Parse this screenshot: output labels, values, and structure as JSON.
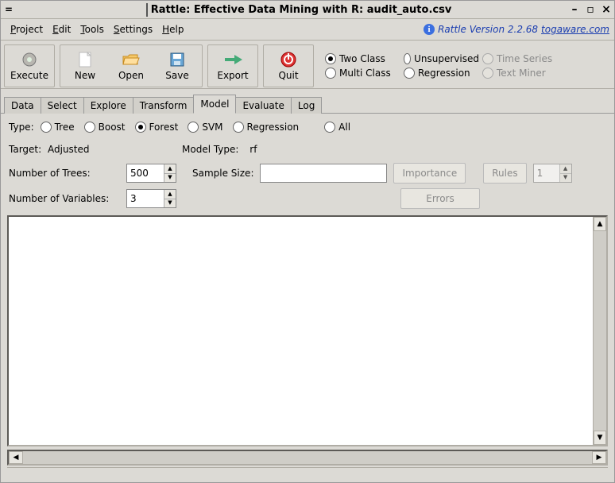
{
  "titlebar": {
    "title": "Rattle: Effective Data Mining with R: audit_auto.csv"
  },
  "menubar": {
    "items": [
      {
        "label": "Project",
        "ul": "P"
      },
      {
        "label": "Edit",
        "ul": "E"
      },
      {
        "label": "Tools",
        "ul": "T"
      },
      {
        "label": "Settings",
        "ul": "S"
      },
      {
        "label": "Help",
        "ul": "H"
      }
    ],
    "version_text": "Rattle Version 2.2.68",
    "version_link": "togaware.com"
  },
  "toolbar": {
    "buttons": [
      {
        "name": "execute",
        "label": "Execute"
      },
      {
        "name": "new",
        "label": "New"
      },
      {
        "name": "open",
        "label": "Open"
      },
      {
        "name": "save",
        "label": "Save"
      },
      {
        "name": "export",
        "label": "Export"
      },
      {
        "name": "quit",
        "label": "Quit"
      }
    ],
    "right_radios_row1": [
      {
        "label": "Two Class",
        "selected": true,
        "disabled": false
      },
      {
        "label": "Unsupervised",
        "selected": false,
        "disabled": false
      },
      {
        "label": "Time Series",
        "selected": false,
        "disabled": true
      }
    ],
    "right_radios_row2": [
      {
        "label": "Multi Class",
        "selected": false,
        "disabled": false
      },
      {
        "label": "Regression",
        "selected": false,
        "disabled": false
      },
      {
        "label": "Text Miner",
        "selected": false,
        "disabled": true
      }
    ]
  },
  "tabs": [
    "Data",
    "Select",
    "Explore",
    "Transform",
    "Model",
    "Evaluate",
    "Log"
  ],
  "active_tab": "Model",
  "model_panel": {
    "type_label": "Type:",
    "type_options": [
      {
        "label": "Tree",
        "selected": false
      },
      {
        "label": "Boost",
        "selected": false
      },
      {
        "label": "Forest",
        "selected": true
      },
      {
        "label": "SVM",
        "selected": false
      },
      {
        "label": "Regression",
        "selected": false
      },
      {
        "label": "All",
        "selected": false
      }
    ],
    "target_label": "Target:",
    "target_value": "Adjusted",
    "model_type_label": "Model Type:",
    "model_type_value": "rf",
    "num_trees_label": "Number of Trees:",
    "num_trees_value": "500",
    "sample_size_label": "Sample Size:",
    "sample_size_value": "",
    "importance_btn": "Importance",
    "rules_btn": "Rules",
    "rules_value": "1",
    "num_vars_label": "Number of Variables:",
    "num_vars_value": "3",
    "errors_btn": "Errors"
  }
}
